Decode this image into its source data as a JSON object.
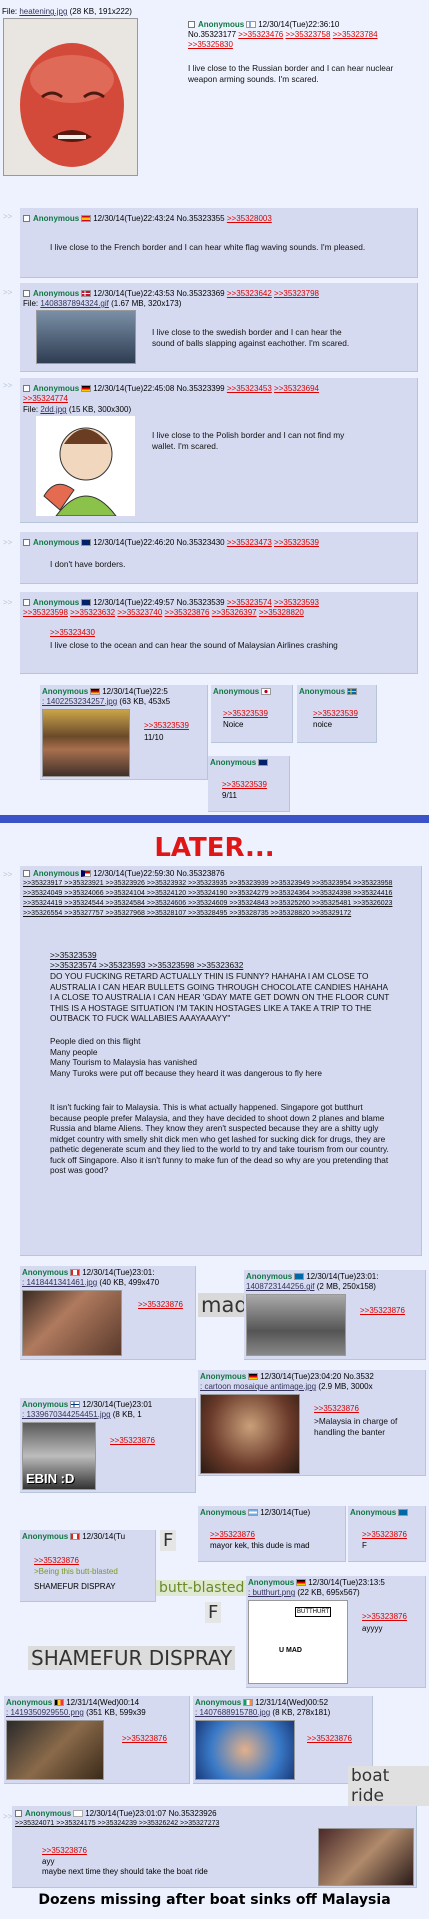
{
  "colors": {
    "name": "#117743",
    "link": "#dd0000",
    "greentext": "#789922",
    "post_bg": "#d6daf0",
    "page_bg": "#eef2ff",
    "later": "#e01616",
    "divider": "#3a54c8"
  },
  "op": {
    "file_label": "File:",
    "file_name": "heatening.jpg",
    "file_meta": "(28 KB, 191x222)",
    "name": "Anonymous",
    "date": "12/30/14(Tue)22:36:10",
    "no": "No.35323177",
    "replies": [
      ">>35323476",
      ">>35323758",
      ">>35323784",
      ">>35325830"
    ],
    "text": "I live close to the Russian border and I can hear nuclear weapon arming sounds. I'm scared."
  },
  "p1": {
    "name": "Anonymous",
    "date": "12/30/14(Tue)22:43:24",
    "no": "No.35323355",
    "replies": [
      ">>35328003"
    ],
    "text": "I live close to the French border and I can hear white flag waving sounds. I'm pleased."
  },
  "p2": {
    "name": "Anonymous",
    "date": "12/30/14(Tue)22:43:53",
    "no": "No.35323369",
    "replies": [
      ">>35323642",
      ">>35323798"
    ],
    "file_label": "File:",
    "file_name": "1408387894324.gif",
    "file_meta": "(1.67 MB, 320x173)",
    "text": "I live close to the swedish border and I can hear the sound of balls slapping against eachother. I'm scared."
  },
  "p3": {
    "name": "Anonymous",
    "date": "12/30/14(Tue)22:45:08",
    "no": "No.35323399",
    "replies": [
      ">>35323453",
      ">>35323694",
      ">>35324774"
    ],
    "file_label": "File:",
    "file_name": "2dd.jpg",
    "file_meta": "(15 KB, 300x300)",
    "text": "I live close to the Polish border and I can not find my wallet. I'm scared."
  },
  "p4": {
    "name": "Anonymous",
    "date": "12/30/14(Tue)22:46:20",
    "no": "No.35323430",
    "replies": [
      ">>35323473",
      ">>35323539"
    ],
    "text": "I don't have borders."
  },
  "p5": {
    "name": "Anonymous",
    "date": "12/30/14(Tue)22:49:57",
    "no": "No.35323539",
    "replies": [
      ">>35323574",
      ">>35323593",
      ">>35323598",
      ">>35323632",
      ">>35323740",
      ">>35323876",
      ">>35326397",
      ">>35328820"
    ],
    "quote": ">>35323430",
    "text": "I live close to the ocean and can hear the sound of Malaysian Airlines crashing"
  },
  "s1": {
    "name": "Anonymous",
    "date": "12/30/14(Tue)22:5",
    "file": ": 1402253234257.jpg",
    "meta": "(63 KB, 453x5",
    "quote": ">>35323539",
    "text": "11/10"
  },
  "s2": {
    "name": "Anonymous",
    "quote": ">>35323539",
    "text": "Noice"
  },
  "s3": {
    "name": "Anonymous",
    "quote": ">>35323539",
    "text": "noice"
  },
  "s4": {
    "name": "Anonymous",
    "quote": ">>35323539",
    "text": "9/11"
  },
  "later": "LATER...",
  "big": {
    "name": "Anonymous",
    "date": "12/30/14(Tue)22:59:30",
    "no": "No.35323876",
    "replies": ">>35323917 >>35323921 >>35323926 >>35323932 >>35323935 >>35323939 >>35323949 >>35323954 >>35323958 >>35324049 >>35324066 >>35324104 >>35324120 >>35324190 >>35324279 >>35324364 >>35324398 >>35324416 >>35324419 >>35324544 >>35324584 >>35324606 >>35324609 >>35324843 >>35325260 >>35325481 >>35326023 >>35326554 >>35327757 >>35327968 >>35328107 >>35328495 >>35328735 >>35328820 >>35329172",
    "quotes1": ">>35323539",
    "quotes2": ">>35323574 >>35323593 >>35323598 >>35323632",
    "caps": "DO YOU FUCKING RETARD ACTUALLY THIN IS FUNNY? HAHAHA I AM CLOSE TO AUSTRALIA I CAN HEAR BULLETS GOING THROUGH CHOCOLATE CANDIES HAHAHA I A CLOSE TO AUSTRALIA I CAN HEAR 'GDAY MATE GET DOWN ON THE FLOOR CUNT THIS IS A HOSTAGE SITUATION I'M TAKIN HOSTAGES LIKE A TAKE A TRIP TO THE OUTBACK TO FUCK WALLABIES AAAYAAAYY\"",
    "para1": "People died on this flight\nMany people\nMany Tourism to Malaysia has vanished\nMany Turoks were put off because they heard it was dangerous to fly here",
    "para2": "It isn't fucking fair to Malaysia. This is what actually happened. Singapore got butthurt because people prefer Malaysia, and they have decided to shoot down 2 planes and blame Russia and blame Aliens. They know they aren't suspected because they are a shitty ugly midget country with smelly shit dick men who get lashed for sucking dick for drugs, they are pathetic degenerate scum and they lied to the world to try and take tourism from our country. fuck off Singapore. Also it isn't funny to make fun of the dead so why are you pretending that post was good?"
  },
  "r1": {
    "name": "Anonymous",
    "date": "12/30/14(Tue)23:01:",
    "file": ": 1418441341461.jpg",
    "meta": "(40 KB, 499x470",
    "quote": ">>35323876"
  },
  "r1_react": "mad",
  "r2": {
    "name": "Anonymous",
    "date": "12/30/14(Tue)23:01:",
    "file": "1408723144256.gif",
    "meta": "(2 MB, 250x158)",
    "quote": ">>35323876"
  },
  "r3": {
    "name": "Anonymous",
    "date": "12/30/14(Tue)23:04:20",
    "no": "No.3532",
    "file": ": cartoon mosaique antimage.jpg",
    "meta": "(2.9 MB, 3000x",
    "quote": ">>35323876",
    "green": ">Malaysia in charge of handling the banter"
  },
  "r4": {
    "name": "Anonymous",
    "date": "12/30/14(Tue)23:01",
    "file": ": 1339670344254451.jpg",
    "meta": "(8 KB, 1",
    "quote": ">>35323876",
    "caption": "EBIN :D"
  },
  "r5": {
    "name": "Anonymous",
    "date": "12/30/14(Tue)",
    "quote": ">>35323876",
    "text": "mayor kek, this dude is mad"
  },
  "r6": {
    "name": "Anonymous",
    "quote": ">>35323876",
    "text": "F"
  },
  "r7": {
    "name": "Anonymous",
    "date": "12/30/14(Tu",
    "quote": ">>35323876",
    "green": ">Being this butt-blasted",
    "text": "SHAMEFUR DISPRAY"
  },
  "f_react": "F",
  "bb_react": "butt-blasted",
  "shame_big": "SHAMEFUR DISPRAY",
  "r8": {
    "name": "Anonymous",
    "date": "12/30/14(Tue)23:13:5",
    "file": ": butthurt.png",
    "meta": "(22 KB, 695x567)",
    "quote": ">>35323876",
    "text": "ayyyy",
    "img_t1": "BUTTHURT",
    "img_t2": "U MAD"
  },
  "r9": {
    "name": "Anonymous",
    "date": "12/31/14(Wed)00:14",
    "file": ": 1419350929550.png",
    "meta": "(351 KB, 599x39",
    "quote": ">>35323876"
  },
  "r10": {
    "name": "Anonymous",
    "date": "12/31/14(Wed)00:52",
    "file": ": 1407688915780.jpg",
    "meta": "(8 KB, 278x181)",
    "quote": ">>35323876"
  },
  "boat_react": "boat ride",
  "r11": {
    "name": "Anonymous",
    "date": "12/30/14(Tue)23:01:07",
    "no": "No.35323926",
    "replies": ">>35324071 >>35324175 >>35324239 >>35326242 >>35327273",
    "quote": ">>35323876",
    "text1": "ayy",
    "text2": "maybe next time they should take the boat ride"
  },
  "headline": "Dozens missing after boat sinks off Malaysia"
}
